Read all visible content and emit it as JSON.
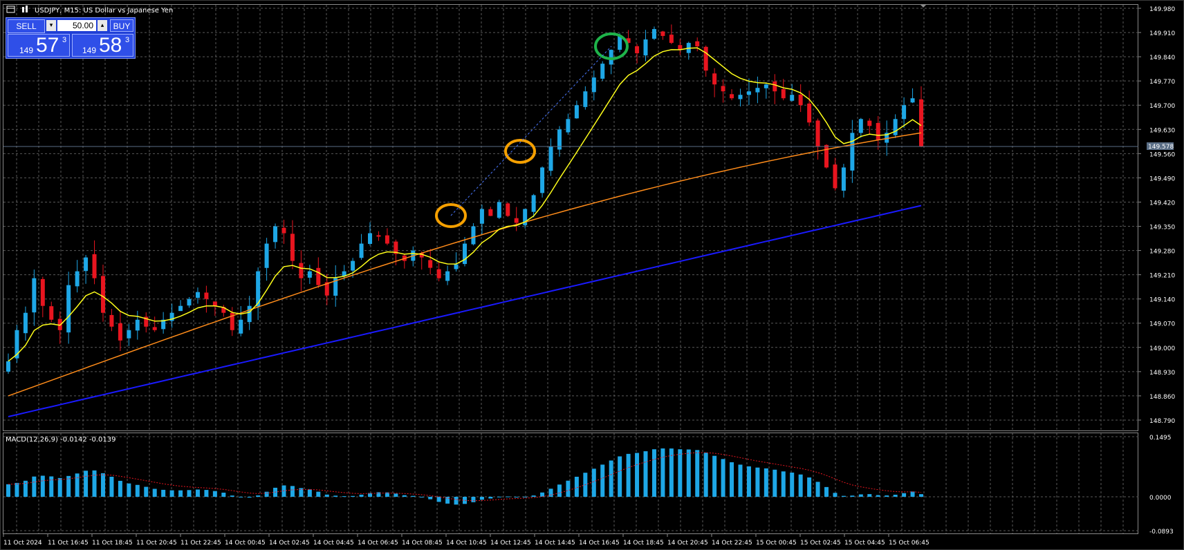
{
  "header": {
    "title": "USDJPY, M15:  US Dollar vs Japanese Yen"
  },
  "trade_panel": {
    "sell_label": "SELL",
    "buy_label": "BUY",
    "lot_value": "50.00",
    "sell_big": "149",
    "sell_digits": "57",
    "sell_sup": "3",
    "buy_big": "149",
    "buy_digits": "58",
    "buy_sup": "3"
  },
  "price_axis": {
    "ticks": [
      "149.980",
      "149.910",
      "149.840",
      "149.770",
      "149.700",
      "149.630",
      "149.560",
      "149.490",
      "149.420",
      "149.350",
      "149.280",
      "149.210",
      "149.140",
      "149.070",
      "149.000",
      "148.930",
      "148.860",
      "148.790"
    ],
    "current_price": "149.578"
  },
  "macd": {
    "label": "MACD(12,26,9) -0.0142 -0.0139",
    "ticks": [
      "0.1495",
      "0.0000",
      "-0.0893"
    ]
  },
  "time_axis": {
    "labels": [
      "11 Oct 2024",
      "11 Oct 16:45",
      "11 Oct 18:45",
      "11 Oct 20:45",
      "11 Oct 22:45",
      "14 Oct 00:45",
      "14 Oct 02:45",
      "14 Oct 04:45",
      "14 Oct 06:45",
      "14 Oct 08:45",
      "14 Oct 10:45",
      "14 Oct 12:45",
      "14 Oct 14:45",
      "14 Oct 16:45",
      "14 Oct 18:45",
      "14 Oct 20:45",
      "14 Oct 22:45",
      "15 Oct 00:45",
      "15 Oct 02:45",
      "15 Oct 04:45",
      "15 Oct 06:45"
    ]
  },
  "colors": {
    "bull": "#1ea7e6",
    "bear": "#e8151f",
    "ma_fast": "#ffff1a",
    "ma_mid": "#ff8c1a",
    "ma_slow": "#1a1aff",
    "grid": "#5a5a5a",
    "circle_orange": "#f5a000",
    "circle_green": "#1eb34a"
  },
  "chart_data": {
    "type": "candlestick",
    "price_range": [
      148.76,
      149.99
    ],
    "close_path": [
      148.96,
      149.05,
      149.1,
      149.2,
      149.12,
      149.08,
      149.05,
      149.18,
      149.22,
      149.26,
      149.2,
      149.1,
      149.06,
      149.02,
      149.05,
      149.08,
      149.06,
      149.05,
      149.08,
      149.1,
      149.12,
      149.14,
      149.16,
      149.14,
      149.12,
      149.1,
      149.05,
      149.08,
      149.12,
      149.22,
      149.3,
      149.35,
      149.33,
      149.25,
      149.2,
      149.22,
      149.18,
      149.15,
      149.2,
      149.22,
      149.25,
      149.3,
      149.33,
      149.32,
      149.3,
      149.27,
      149.25,
      149.28,
      149.26,
      149.23,
      149.2,
      149.22,
      149.24,
      149.3,
      149.35,
      149.4,
      149.38,
      149.42,
      149.38,
      149.36,
      149.4,
      149.44,
      149.52,
      149.58,
      149.63,
      149.66,
      149.7,
      149.74,
      149.78,
      149.82,
      149.86,
      149.9,
      149.88,
      149.85,
      149.89,
      149.92,
      149.9,
      149.88,
      149.86,
      149.88,
      149.87,
      149.8,
      149.76,
      149.74,
      149.72,
      149.73,
      149.74,
      149.75,
      149.76,
      149.74,
      149.72,
      149.73,
      149.7,
      149.65,
      149.58,
      149.52,
      149.46,
      149.52,
      149.62,
      149.66,
      149.64,
      149.6,
      149.62,
      149.66,
      149.7,
      149.72,
      149.58
    ],
    "ma_fast_endpoints": [
      148.93,
      149.65
    ],
    "ma_mid_endpoints": [
      148.86,
      149.62
    ],
    "ma_slow_endpoints": [
      148.8,
      149.41
    ]
  }
}
